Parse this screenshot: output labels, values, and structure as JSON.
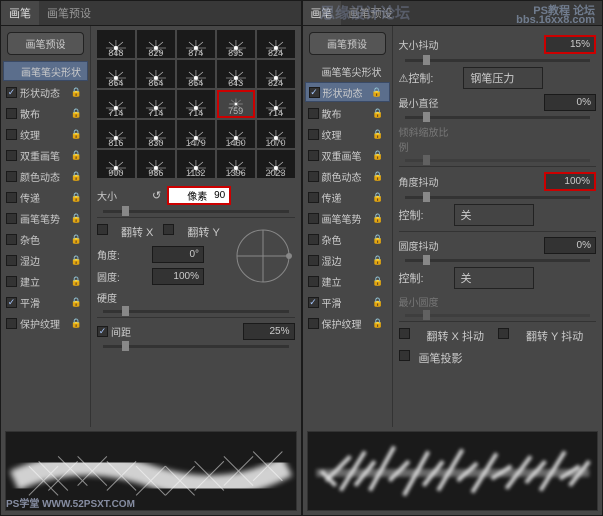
{
  "watermarks": {
    "tl": "思缘设计论坛",
    "tr": "PS教程 论坛",
    "tr2": "bbs.16xx8.com",
    "bl": "PS学堂  WWW.52PSXT.COM"
  },
  "tabs": {
    "brush": "画笔",
    "preset": "画笔预设"
  },
  "sidebar": {
    "presetBtn": "画笔预设",
    "items": [
      {
        "label": "画笔笔尖形状",
        "lock": false,
        "cb": null,
        "active_left": true
      },
      {
        "label": "形状动态",
        "lock": true,
        "cb": true,
        "active_right": true
      },
      {
        "label": "散布",
        "lock": true,
        "cb": false
      },
      {
        "label": "纹理",
        "lock": true,
        "cb": false
      },
      {
        "label": "双重画笔",
        "lock": true,
        "cb": false
      },
      {
        "label": "颜色动态",
        "lock": true,
        "cb": false
      },
      {
        "label": "传递",
        "lock": true,
        "cb": false
      },
      {
        "label": "画笔笔势",
        "lock": true,
        "cb": false
      },
      {
        "label": "杂色",
        "lock": true,
        "cb": false
      },
      {
        "label": "湿边",
        "lock": true,
        "cb": false
      },
      {
        "label": "建立",
        "lock": true,
        "cb": false
      },
      {
        "label": "平滑",
        "lock": true,
        "cb": true
      },
      {
        "label": "保护纹理",
        "lock": true,
        "cb": false
      }
    ]
  },
  "brushes": [
    848,
    829,
    874,
    895,
    824,
    864,
    864,
    864,
    643,
    824,
    714,
    714,
    714,
    759,
    714,
    816,
    830,
    1479,
    1460,
    1070,
    900,
    986,
    1132,
    1396,
    2023
  ],
  "selectedBrush": 759,
  "left": {
    "size": {
      "label": "大小",
      "value": "90",
      "unit": "像素"
    },
    "flipX": "翻转 X",
    "flipY": "翻转 Y",
    "angle": {
      "label": "角度:",
      "value": "0°"
    },
    "round": {
      "label": "圆度:",
      "value": "100%"
    },
    "hardness": "硬度",
    "spacing": {
      "label": "间距",
      "value": "25%"
    }
  },
  "right": {
    "sizeJitter": {
      "label": "大小抖动",
      "value": "15%"
    },
    "control": "控制:",
    "penPressure": "钢笔压力",
    "minDia": {
      "label": "最小直径",
      "value": "0%"
    },
    "tiltScale": "倾斜缩放比例",
    "angleJitter": {
      "label": "角度抖动",
      "value": "100%"
    },
    "control2": "控制:",
    "off": "关",
    "roundJitter": {
      "label": "圆度抖动",
      "value": "0%"
    },
    "control3": "控制:",
    "off2": "关",
    "minRound": "最小圆度",
    "flipXJ": "翻转 X 抖动",
    "flipYJ": "翻转 Y 抖动",
    "brushProj": "画笔投影"
  }
}
